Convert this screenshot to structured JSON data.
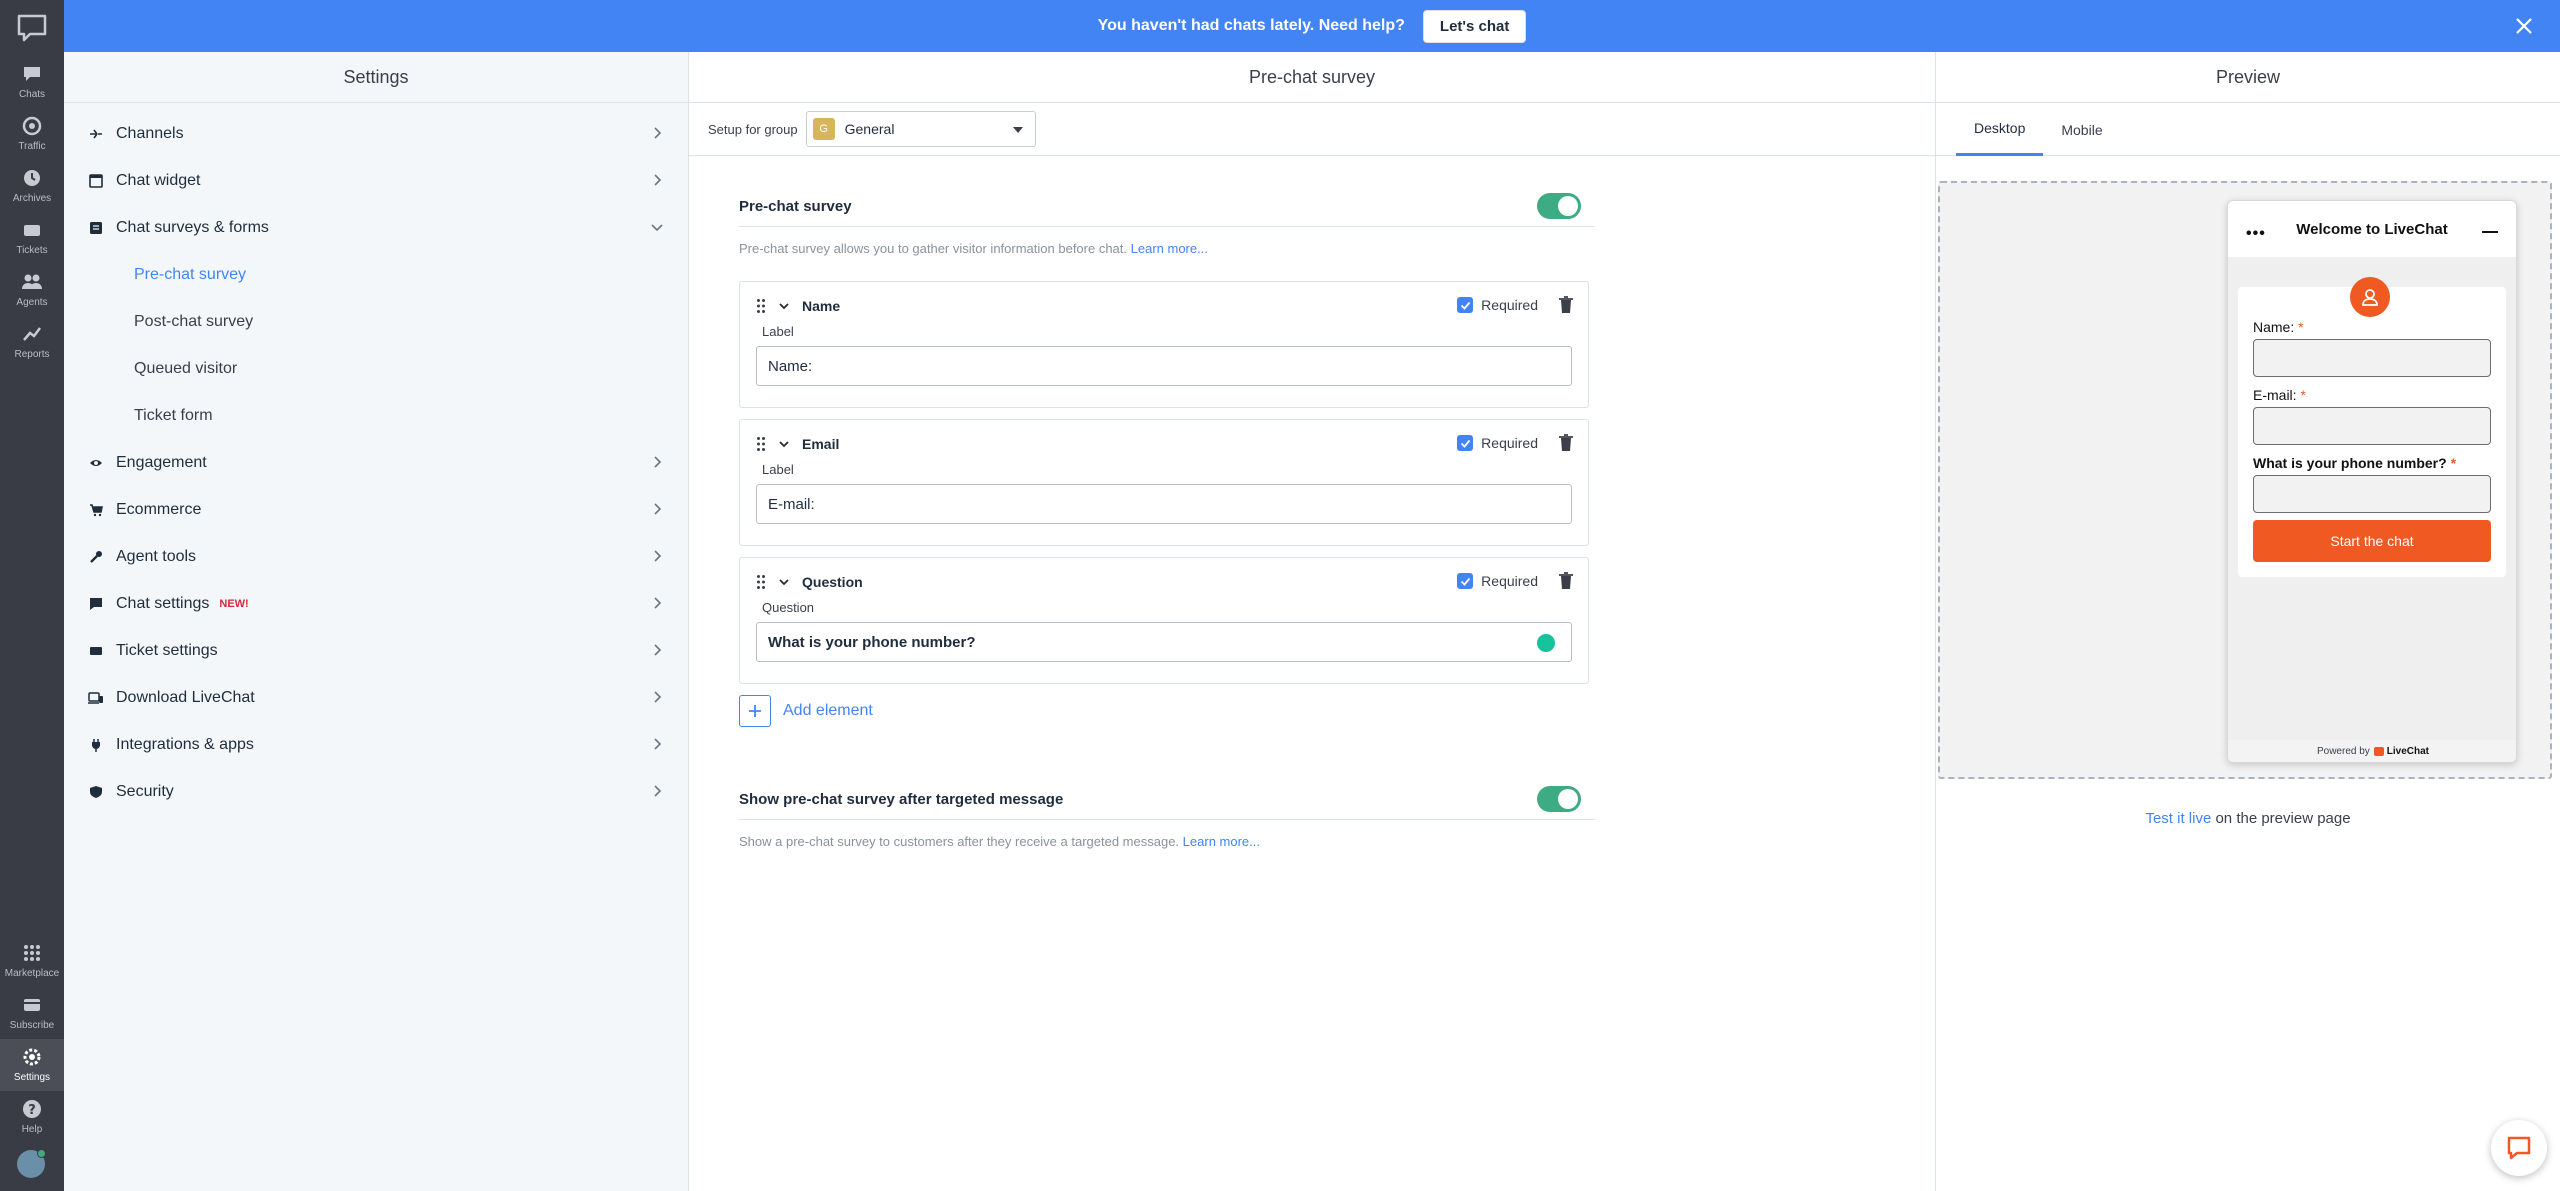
{
  "banner": {
    "text": "You haven't had chats lately. Need help?",
    "button_label": "Let's chat"
  },
  "rail": {
    "items": [
      {
        "label": "Chats",
        "icon": "chat-bubble-icon"
      },
      {
        "label": "Traffic",
        "icon": "traffic-icon"
      },
      {
        "label": "Archives",
        "icon": "archives-icon"
      },
      {
        "label": "Tickets",
        "icon": "tickets-icon"
      },
      {
        "label": "Agents",
        "icon": "agents-icon"
      },
      {
        "label": "Reports",
        "icon": "reports-icon"
      }
    ],
    "bottom_items": [
      {
        "label": "Marketplace",
        "icon": "marketplace-icon"
      },
      {
        "label": "Subscribe",
        "icon": "subscribe-icon"
      },
      {
        "label": "Settings",
        "icon": "gear-icon"
      },
      {
        "label": "Help",
        "icon": "help-icon"
      }
    ]
  },
  "settings": {
    "title": "Settings",
    "nav": [
      {
        "label": "Channels",
        "icon": "channels-icon"
      },
      {
        "label": "Chat widget",
        "icon": "chat-widget-icon"
      },
      {
        "label": "Chat surveys & forms",
        "icon": "forms-icon"
      },
      {
        "label": "Engagement",
        "icon": "eye-icon"
      },
      {
        "label": "Ecommerce",
        "icon": "cart-icon"
      },
      {
        "label": "Agent tools",
        "icon": "wrench-icon"
      },
      {
        "label": "Chat settings",
        "icon": "chat-settings-icon",
        "badge": "NEW!"
      },
      {
        "label": "Ticket settings",
        "icon": "ticket-icon"
      },
      {
        "label": "Download LiveChat",
        "icon": "download-icon"
      },
      {
        "label": "Integrations & apps",
        "icon": "plug-icon"
      },
      {
        "label": "Security",
        "icon": "shield-icon"
      }
    ],
    "sub_items": [
      "Pre-chat survey",
      "Post-chat survey",
      "Queued visitor",
      "Ticket form"
    ]
  },
  "main": {
    "title": "Pre-chat survey",
    "group_label": "Setup for group",
    "group_initial": "G",
    "group_name": "General",
    "section1": {
      "title": "Pre-chat survey",
      "desc": "Pre-chat survey allows you to gather visitor information before chat.",
      "link": "Learn more..."
    },
    "cards": [
      {
        "title": "Name",
        "required": "Required",
        "field_label": "Label",
        "value": "Name:"
      },
      {
        "title": "Email",
        "required": "Required",
        "field_label": "Label",
        "value": "E-mail:"
      },
      {
        "title": "Question",
        "required": "Required",
        "field_label": "Question",
        "value": "What is your phone number?"
      }
    ],
    "add_element": "Add element",
    "section2": {
      "title": "Show pre-chat survey after targeted message",
      "desc": "Show a pre-chat survey to customers after they receive a targeted message.",
      "link": "Learn more..."
    }
  },
  "preview": {
    "title": "Preview",
    "tabs": [
      "Desktop",
      "Mobile"
    ],
    "widget": {
      "title": "Welcome to LiveChat",
      "dots": "•••",
      "fields": [
        "Name:",
        "E-mail:",
        "What is your phone number?"
      ],
      "required_mark": "*",
      "button": "Start the chat",
      "powered_by": "Powered by",
      "brand": "LiveChat"
    },
    "test_link": "Test it live",
    "test_rest": " on the preview page"
  },
  "colors": {
    "accent": "#4384f5",
    "toggle_on": "#3dac84",
    "livechat_orange": "#f05a22"
  }
}
